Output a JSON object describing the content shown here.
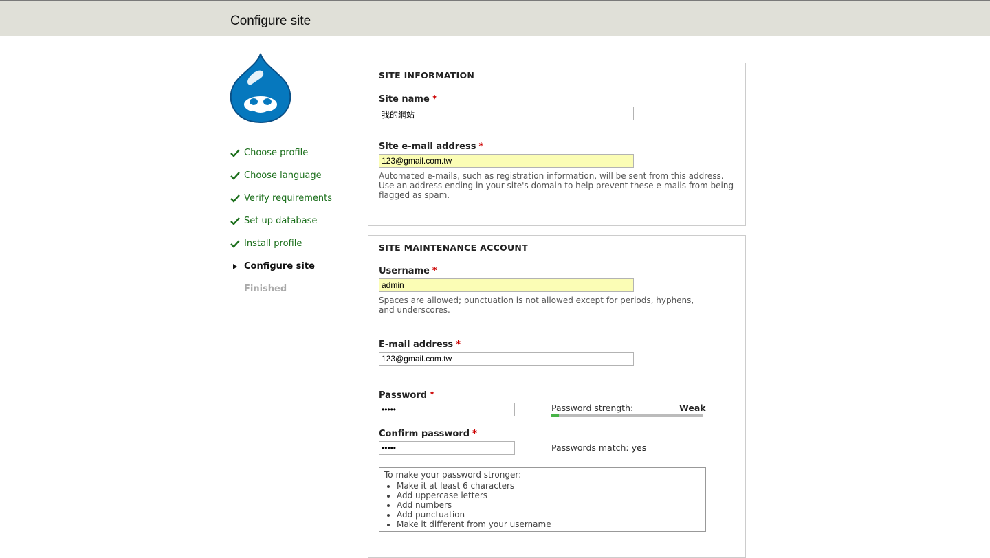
{
  "header": {
    "title": "Configure site"
  },
  "logo": {
    "icon": "drupal-drop-logo",
    "color": "#0678be"
  },
  "steps": [
    {
      "label": "Choose profile",
      "status": "done"
    },
    {
      "label": "Choose language",
      "status": "done"
    },
    {
      "label": "Verify requirements",
      "status": "done"
    },
    {
      "label": "Set up database",
      "status": "done"
    },
    {
      "label": "Install profile",
      "status": "done"
    },
    {
      "label": "Configure site",
      "status": "active"
    },
    {
      "label": "Finished",
      "status": "todo"
    }
  ],
  "site_info": {
    "legend": "SITE INFORMATION",
    "site_name_label": "Site name",
    "site_name_value": "我的網站",
    "site_email_label": "Site e-mail address",
    "site_email_value": "123@gmail.com.tw",
    "site_email_desc": "Automated e-mails, such as registration information, will be sent from this address. Use an address ending in your site's domain to help prevent these e-mails from being flagged as spam."
  },
  "account": {
    "legend": "SITE MAINTENANCE ACCOUNT",
    "username_label": "Username",
    "username_value": "admin",
    "username_desc": "Spaces are allowed; punctuation is not allowed except for periods, hyphens, and underscores.",
    "email_label": "E-mail address",
    "email_value": "123@gmail.com.tw",
    "password_label": "Password",
    "password_value": "•••••",
    "confirm_label": "Confirm password",
    "confirm_value": "•••••",
    "strength_label": "Password strength:",
    "strength_value": "Weak",
    "strength_fraction": 0.05,
    "strength_color": "#47b347",
    "match_label": "Passwords match:",
    "match_value": "yes",
    "suggest_title": "To make your password stronger:",
    "suggestions": [
      "Make it at least 6 characters",
      "Add uppercase letters",
      "Add numbers",
      "Add punctuation",
      "Make it different from your username"
    ]
  },
  "required_marker": "*"
}
